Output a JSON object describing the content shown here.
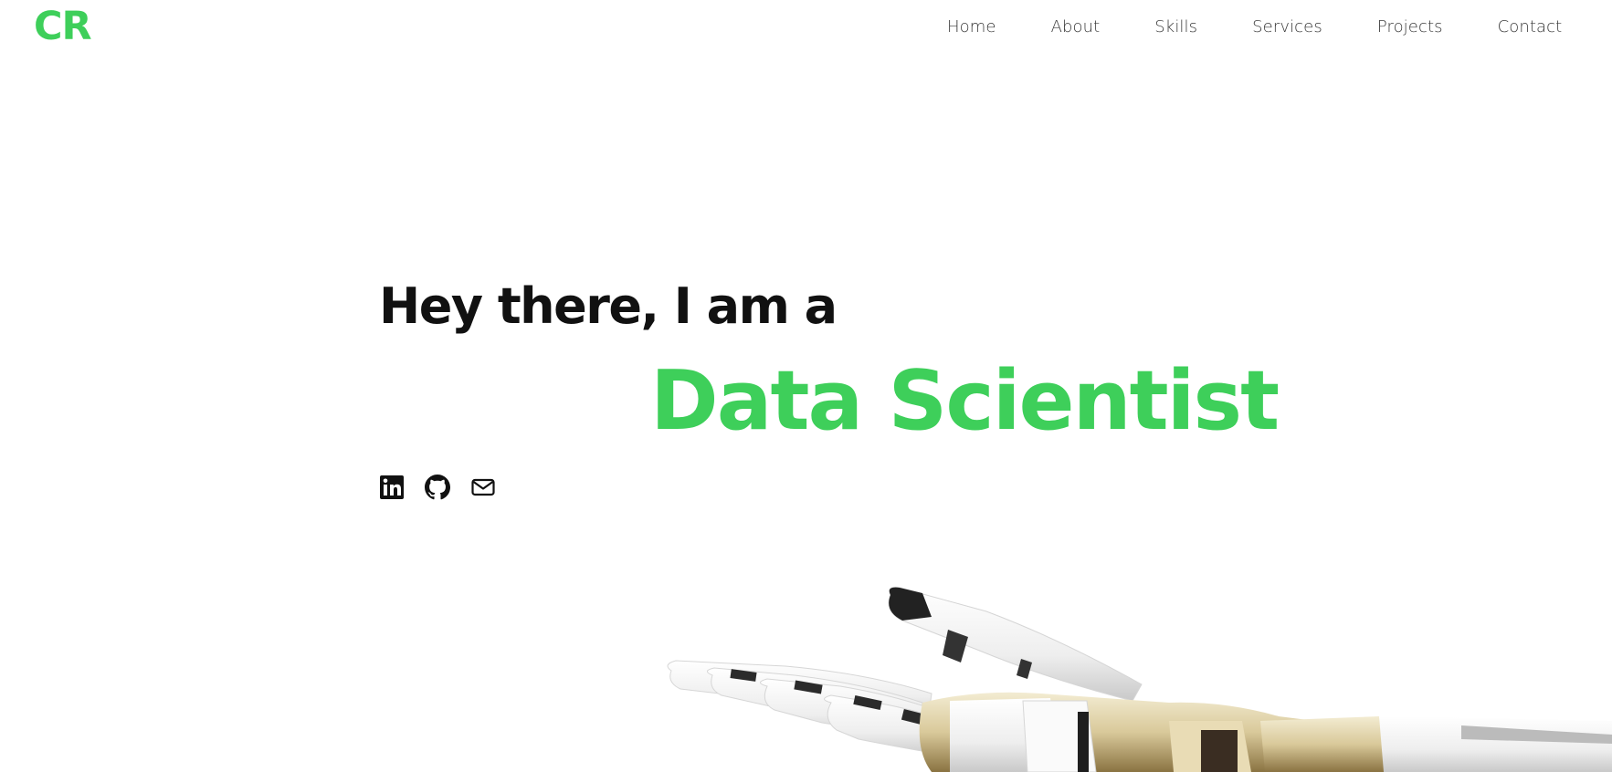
{
  "brand": {
    "logo_text": "CR",
    "accent_color": "#3ecf5a"
  },
  "nav": {
    "items": [
      {
        "label": "Home"
      },
      {
        "label": "About"
      },
      {
        "label": "Skills"
      },
      {
        "label": "Services"
      },
      {
        "label": "Projects"
      },
      {
        "label": "Contact"
      }
    ]
  },
  "hero": {
    "intro": "Hey there, I am a",
    "role": "Data Scientist",
    "socials": [
      {
        "icon": "linkedin-icon"
      },
      {
        "icon": "github-icon"
      },
      {
        "icon": "mail-icon"
      }
    ],
    "image": "robot-hand"
  }
}
